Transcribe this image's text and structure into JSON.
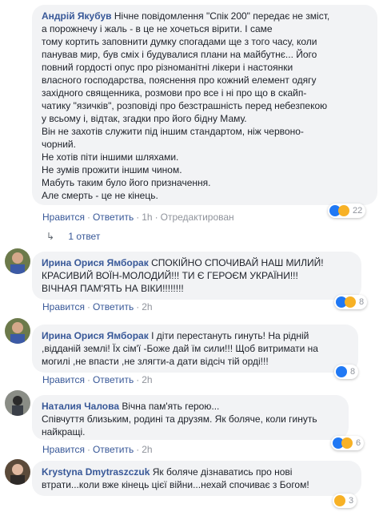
{
  "comments": [
    {
      "author": "Андрій Якубув",
      "text": "Нічне повідомлення \"Спік 200\" передає не зміст,\nа порожнечу і жаль - в це не хочеться вірити. І саме\nтому кортить заповнити думку спогадами ще з того часу, коли\nпанував мир, був сміх і будувалися плани на майбутнє... Його\nповний гордості опус про різноманітні лікери і настоянки\nвласного господарства, пояснення про кожний елемент одягу\nзахідного священника, розмови про все і ні про що в скайп-\nчатику \"язичків\", розповіді про безстрашність перед небезпекою\nу всьому і, відтак, згадки про його бідну Маму.\nВін не захотів служити під іншим стандартом, ніж червоно-\nчорний.\nНе хотів піти іншими шляхами.\nНе зумів прожити іншим чином.\nМабуть таким було його призначення.\nАле смерть - це не кінець.",
      "actions": {
        "like": "Нравится",
        "reply": "Ответить",
        "time": "1h",
        "edited": "Отредактирован"
      },
      "reaction_count": "22",
      "replies": "1 ответ"
    },
    {
      "author": "Ирина Орися Ямборак",
      "text": "СПОКІЙНО СПОЧИВАЙ НАШ МИЛИЙ!\nКРАСИВИЙ ВОЇН-МОЛОДИЙ!!! ТИ Є ГЕРОЄМ УКРАЇНИ!!!\nВІЧНАЯ ПАМ'ЯТЬ НА ВІКИ!!!!!!!!",
      "actions": {
        "like": "Нравится",
        "reply": "Ответить",
        "time": "2h"
      },
      "reaction_count": "8"
    },
    {
      "author": "Ирина Орися Ямборак",
      "text": "І діти перестануть гинуть! На рідній\n,відданій землі! Їх сім'ї -Боже дай їм сили!!! Щоб витримати на\nмогилі ,не впасти ,не злягти-а дати відсіч тій орді!!!",
      "actions": {
        "like": "Нравится",
        "reply": "Ответить",
        "time": "2h"
      },
      "reaction_count": "8"
    },
    {
      "author": "Наталия Чалова",
      "text": "Вічна пам'ять герою...\nСпівчуття близьким, родині та друзям. Як боляче, коли гинуть\nнайкращі.",
      "actions": {
        "like": "Нравится",
        "reply": "Ответить",
        "time": "2h"
      },
      "reaction_count": "6"
    },
    {
      "author": "Krystyna Dmytraszczuk",
      "text": "Як боляче дізнаватись про нові\nвтрати...коли вже кінець цієї війни...нехай спочиває з Богом!",
      "reaction_count": "3"
    }
  ]
}
